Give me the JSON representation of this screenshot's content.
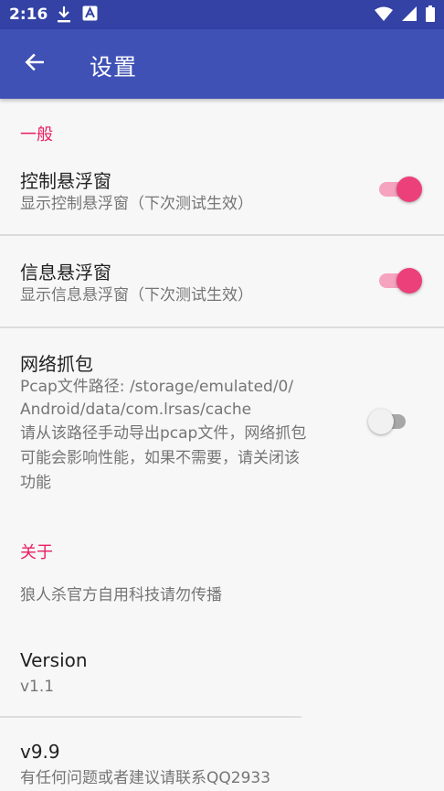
{
  "status_bar": {
    "time": "2:16",
    "icons": [
      "download-icon",
      "a-badge-icon",
      "wifi-icon",
      "signal-icon",
      "battery-icon"
    ]
  },
  "app_bar": {
    "title": "设置",
    "back_icon": "arrow-left-icon"
  },
  "colors": {
    "status_bar": "#3342a4",
    "app_bar": "#3f51b5",
    "accent": "#e91e63",
    "switch_on": "#ec407a"
  },
  "sections": {
    "general": {
      "header": "一般",
      "items": [
        {
          "title": "控制悬浮窗",
          "summary": "显示控制悬浮窗（下次测试生效）",
          "checked": true
        },
        {
          "title": "信息悬浮窗",
          "summary": "显示信息悬浮窗（下次测试生效）",
          "checked": true
        },
        {
          "title": "网络抓包",
          "summary_lines": [
            "Pcap文件路径: /storage/emulated/0/",
            "Android/data/com.lrsas/cache",
            "请从该路径手动导出pcap文件，网络抓包",
            "可能会影响性能，如果不需要，请关闭该",
            "功能"
          ],
          "checked": false
        }
      ]
    },
    "about": {
      "header": "关于",
      "notice": "狼人杀官方自用科技请勿传播",
      "version": {
        "title": "Version",
        "summary": "v1.1"
      },
      "contact": {
        "title": "v9.9",
        "summary": "有任何问题或者建议请联系QQ2933"
      }
    }
  }
}
